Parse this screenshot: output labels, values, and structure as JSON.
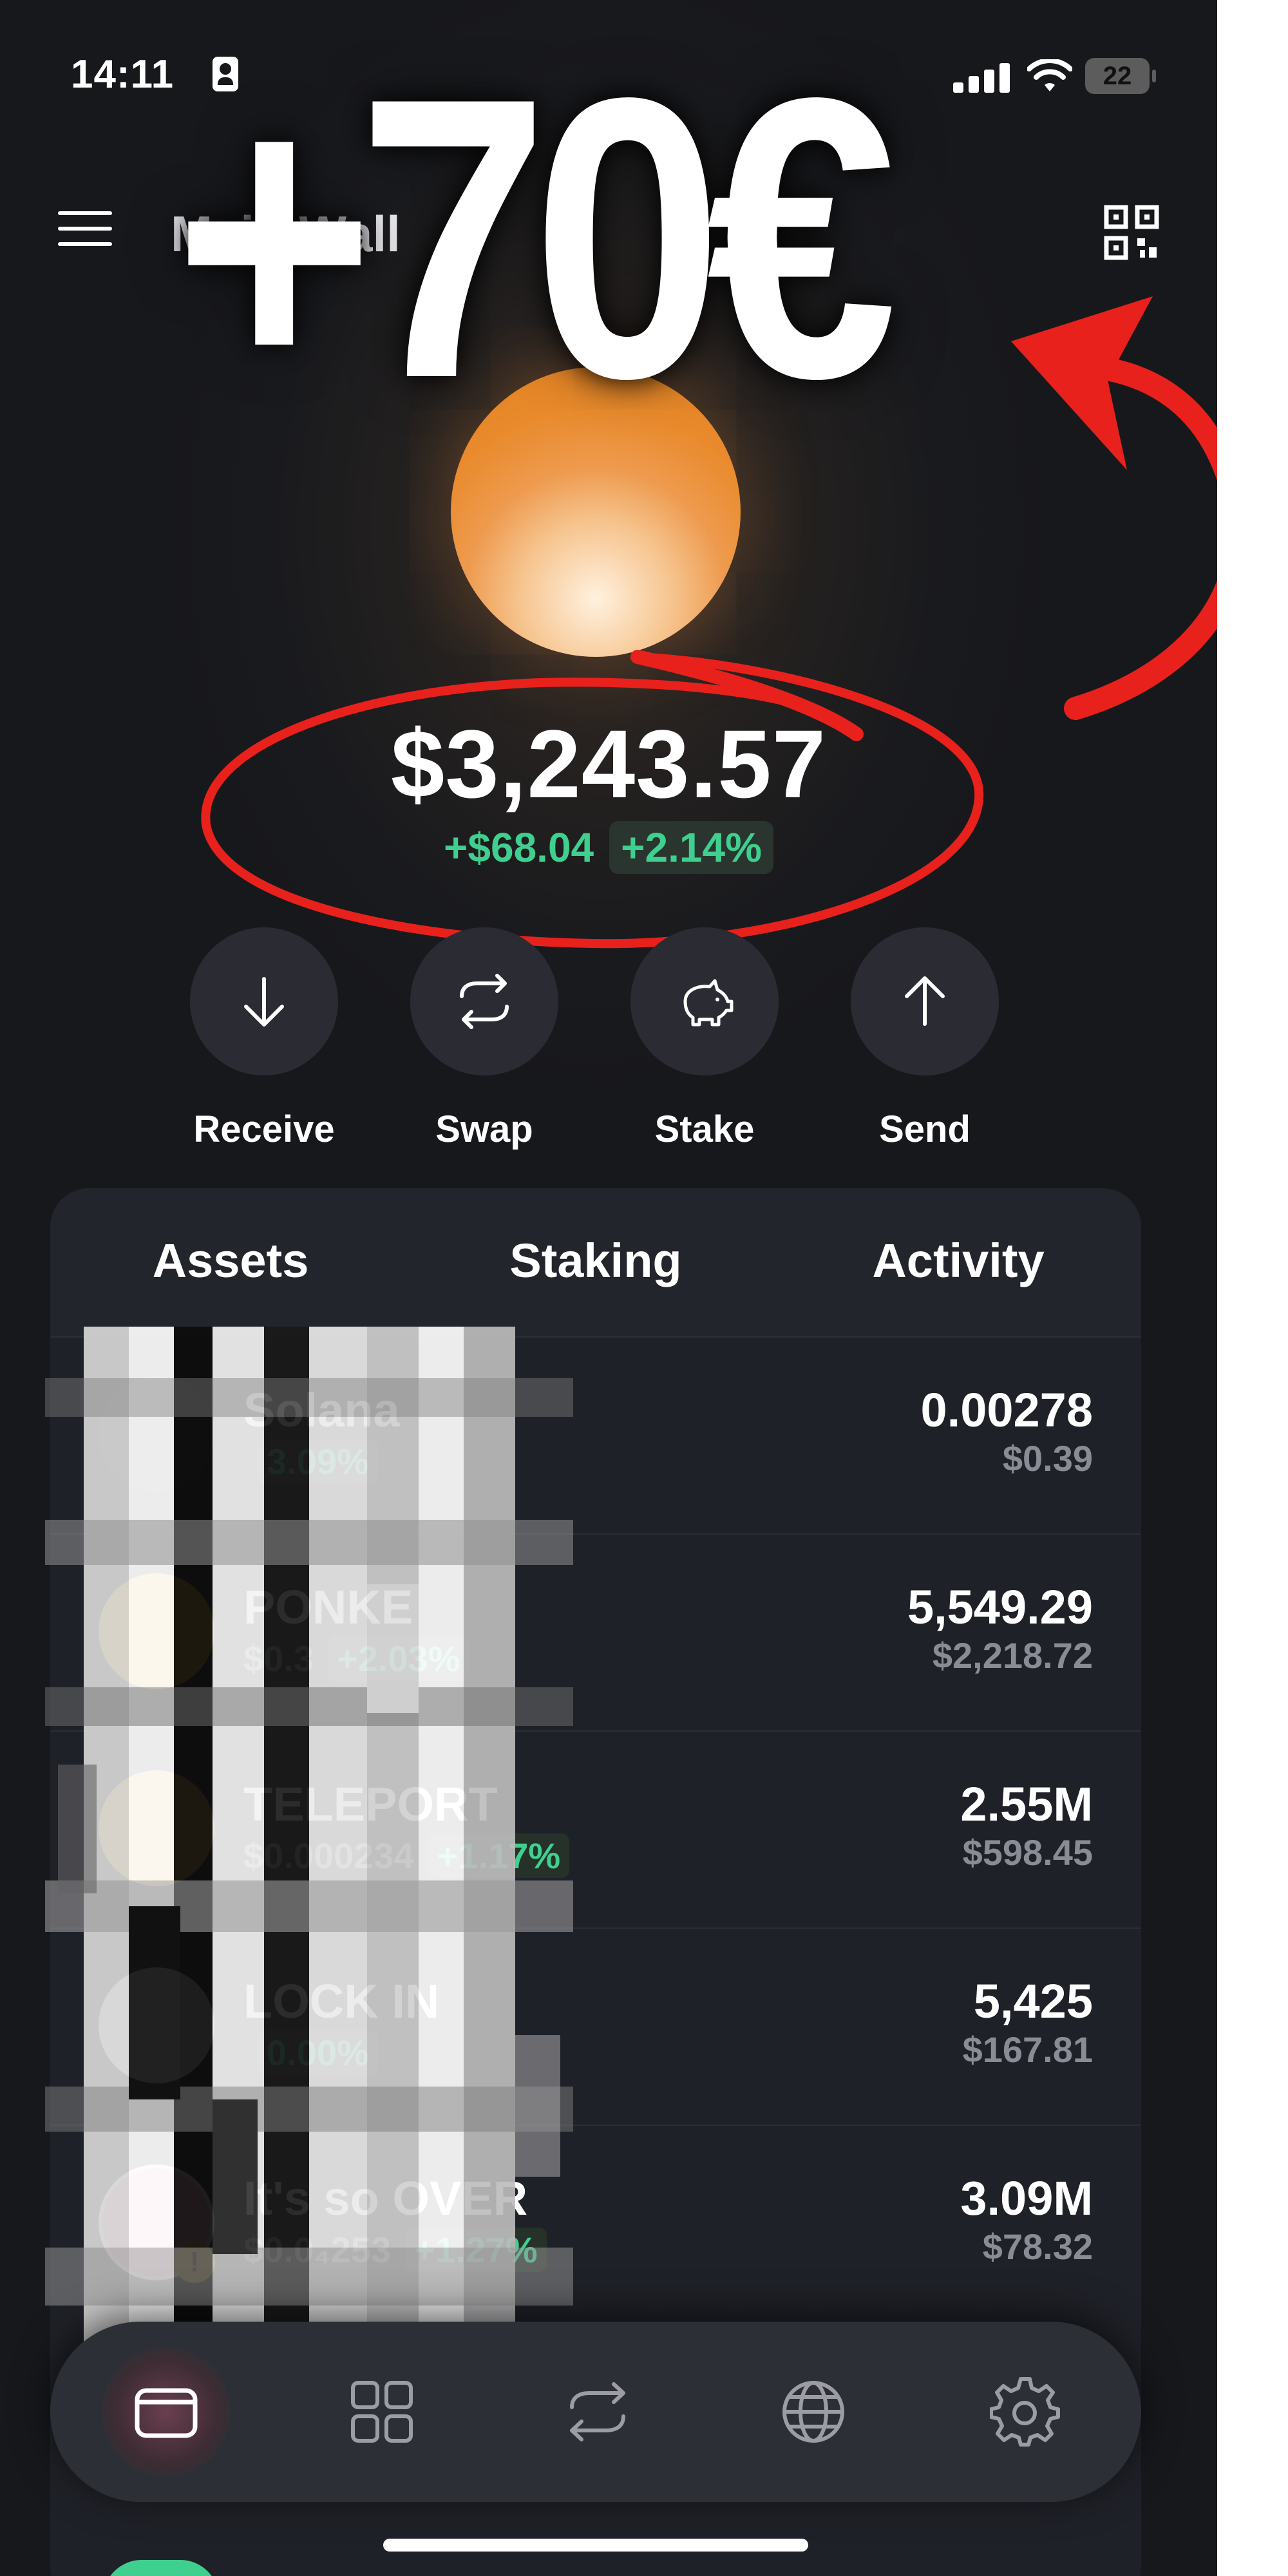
{
  "status_bar": {
    "time": "14:11",
    "battery": "22"
  },
  "header": {
    "wallet_name": "Main Wall"
  },
  "overlay": {
    "promo_text": "+70€"
  },
  "balance": {
    "total": "$3,243.57",
    "change_abs": "+$68.04",
    "change_pct": "+2.14%"
  },
  "actions": [
    {
      "label": "Receive",
      "icon": "arrow-down-icon"
    },
    {
      "label": "Swap",
      "icon": "swap-icon"
    },
    {
      "label": "Stake",
      "icon": "piggy-bank-icon"
    },
    {
      "label": "Send",
      "icon": "arrow-up-icon"
    }
  ],
  "tabs": [
    "Assets",
    "Staking",
    "Activity"
  ],
  "assets": [
    {
      "name": "Solana",
      "price": "",
      "change": "3.09%",
      "amount": "0.00278",
      "value": "$0.39"
    },
    {
      "name": "PONKE",
      "price": "$0.3",
      "change": "+2.03%",
      "amount": "5,549.29",
      "value": "$2,218.72"
    },
    {
      "name": "TELEPORT",
      "price": "$0.000234",
      "change": "+1.17%",
      "amount": "2.55M",
      "value": "$598.45"
    },
    {
      "name": "LOCK IN",
      "price": "",
      "change": "0.00%",
      "amount": "5,425",
      "value": "$167.81"
    },
    {
      "name": "It's so OVER",
      "price": "$0.0₄253",
      "change": "+1.27%",
      "amount": "3.09M",
      "value": "$78.32"
    }
  ],
  "nav": [
    "wallet-icon",
    "grid-icon",
    "swap-icon",
    "globe-icon",
    "gear-icon"
  ],
  "colors": {
    "accent_green": "#3fcf8e",
    "annotation_red": "#e8211c",
    "background": "#17181c",
    "token_orange": "#e98a2c"
  }
}
